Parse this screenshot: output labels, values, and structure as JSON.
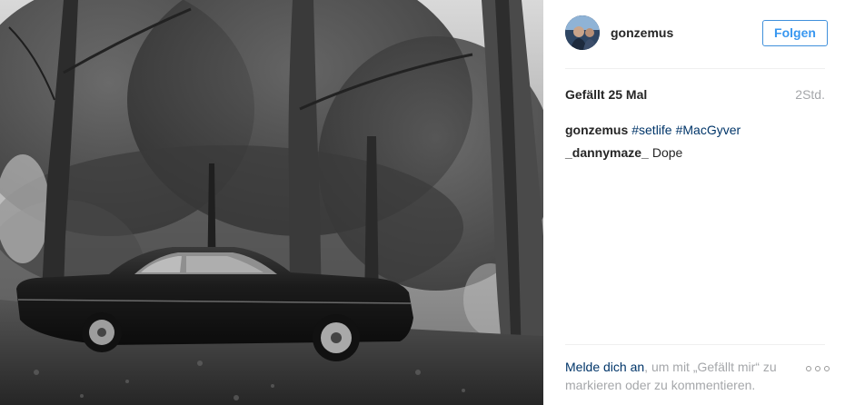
{
  "post": {
    "photo_alt": "black and white photo of a classic car in a forest",
    "header": {
      "username": "gonzemus",
      "follow_label": "Folgen"
    },
    "likes": "Gefällt 25 Mal",
    "time": "2Std.",
    "caption": {
      "author": "gonzemus",
      "hashtags": [
        "#setlife",
        "#MacGyver"
      ]
    },
    "comments": [
      {
        "author": "_dannymaze_",
        "text": "Dope"
      }
    ],
    "footer": {
      "login_link": "Melde dich an",
      "login_rest": ", um mit „Gefällt mir“ zu markieren oder zu kommentieren."
    }
  },
  "colors": {
    "link": "#003569",
    "follow_blue": "#3897f0",
    "muted": "#a5a7aa",
    "text": "#262626"
  },
  "icons": {
    "more": "more-options-icon"
  }
}
